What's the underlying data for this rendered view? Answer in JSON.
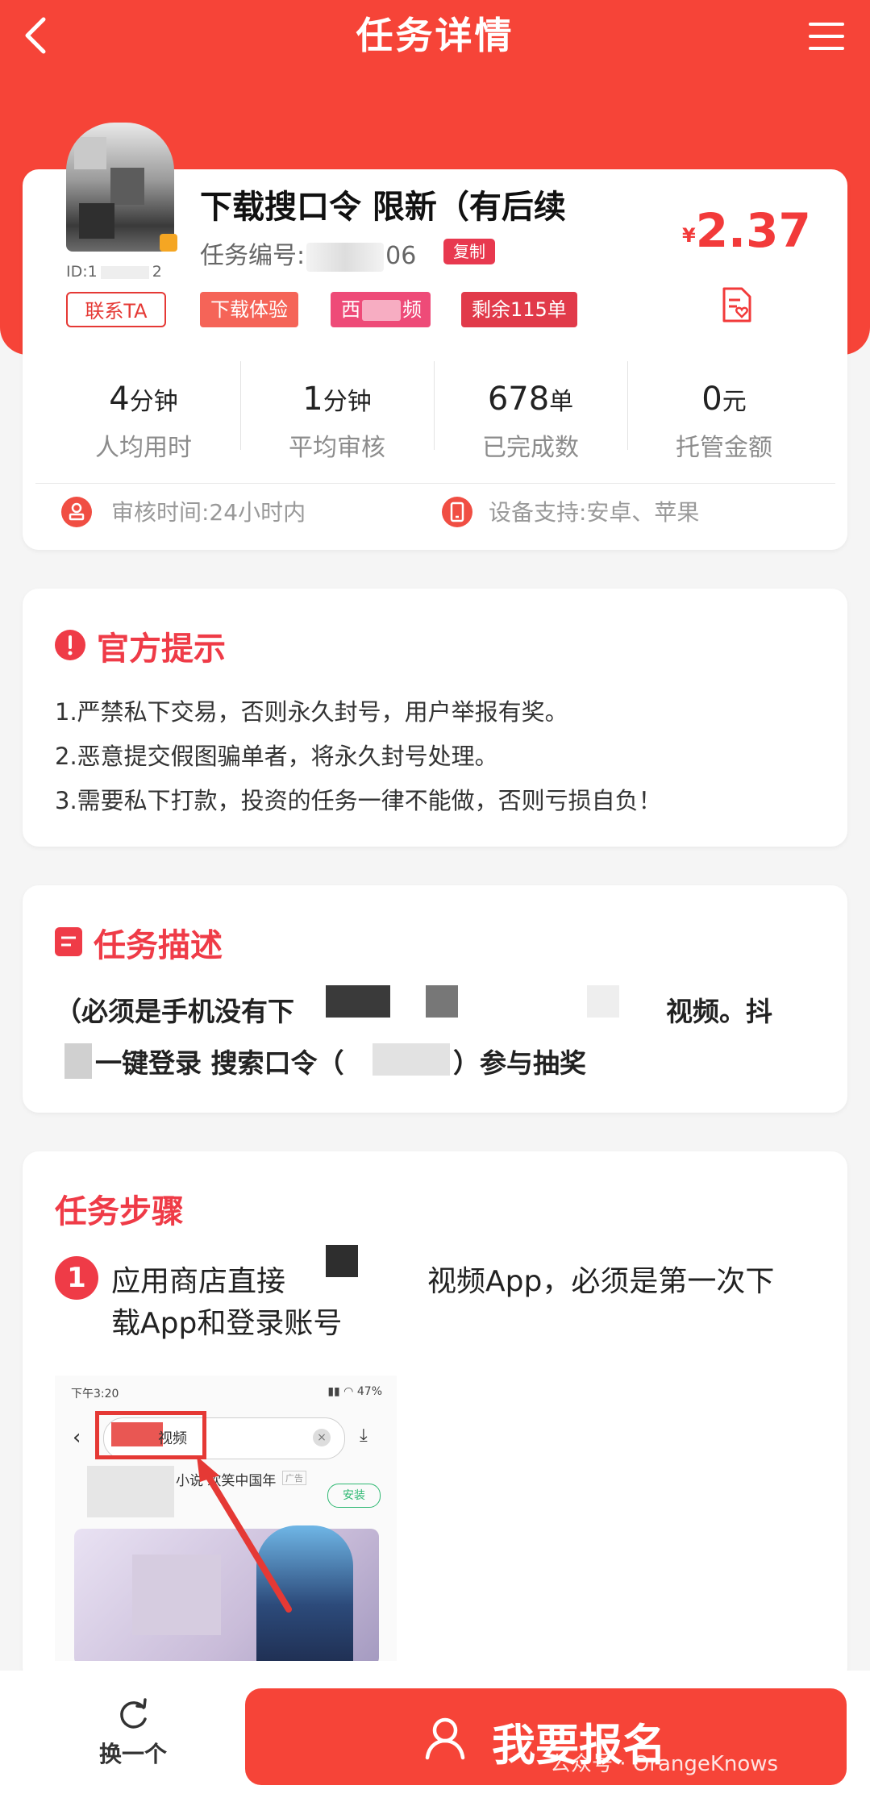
{
  "header": {
    "title": "任务详情"
  },
  "task": {
    "uid_prefix": "ID:1",
    "uid_suffix": "2",
    "contact_label": "联系TA",
    "title": "下载搜口令 限新（有后续",
    "id_label": "任务编号:",
    "id_tail": "06",
    "copy_label": "复制",
    "tags": [
      "下载体验",
      "西",
      "频",
      "剩余115单"
    ],
    "price_symbol": "¥",
    "price": "2.37"
  },
  "stats": [
    {
      "value": "4",
      "unit": "分钟",
      "label": "人均用时"
    },
    {
      "value": "1",
      "unit": "分钟",
      "label": "平均审核"
    },
    {
      "value": "678",
      "unit": "单",
      "label": "已完成数"
    },
    {
      "value": "0",
      "unit": "元",
      "label": "托管金额"
    }
  ],
  "meta": {
    "review_time": "审核时间:24小时内",
    "devices": "设备支持:安卓、苹果"
  },
  "tips": {
    "title": "官方提示",
    "lines": [
      "1.严禁私下交易，否则永久封号，用户举报有奖。",
      "2.恶意提交假图骗单者，将永久封号处理。",
      "3.需要私下打款，投资的任务一律不能做，否则亏损自负！"
    ]
  },
  "description": {
    "title": "任务描述",
    "line1_a": "（必须是手机没有下",
    "line1_b": "视频。抖",
    "line2_a": "一键登录 搜索口令（",
    "line2_b": "）参与抽奖"
  },
  "steps": {
    "title": "任务步骤",
    "step1_num": "1",
    "step1_line1_a": "应用商店直接",
    "step1_line1_b": "视频App，必须是第一次下",
    "step1_line2": "载App和登录账号",
    "screenshot": {
      "status_time": "下午3:20",
      "status_right": "47",
      "search_text": "视频",
      "app_name": "小说 欢笑中国年",
      "ad": "广告",
      "install": "安装"
    }
  },
  "bottom": {
    "refresh_label": "换一个",
    "signup_label": "我要报名",
    "watermark": "公众号 · OrangeKnows"
  },
  "colors": {
    "brand": "#f64438",
    "accent": "#ef3b47",
    "price": "#f23a3a"
  }
}
